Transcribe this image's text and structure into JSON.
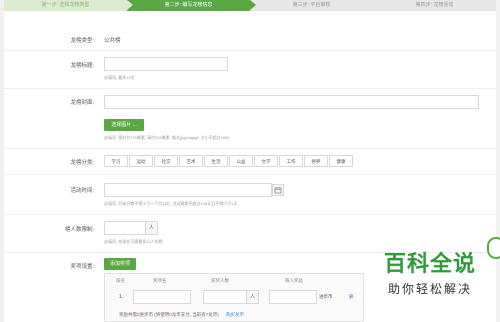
{
  "steps": [
    {
      "label": "第一步: 选择龙榜类型"
    },
    {
      "label": "第二步: 编写龙榜信息"
    },
    {
      "label": "第三步: 平台审核"
    },
    {
      "label": "第四步: 龙榜活动"
    }
  ],
  "form": {
    "type": {
      "label": "龙榜类型:",
      "value": "公共榜"
    },
    "title": {
      "label": "龙榜标题:",
      "value": "",
      "hint": "必填项, 最多15字"
    },
    "cover": {
      "label": "龙榜封面:",
      "button": "选择图片 ...",
      "hint": "必填项, 宽约为700像素, 高约200像素, 格式jpg/png/gif, 大小不超过100K"
    },
    "category": {
      "label": "龙榜分类:",
      "options": [
        "学习",
        "运动",
        "社交",
        "艺术",
        "生活",
        "公益",
        "文学",
        "工作",
        "修养",
        "健康"
      ]
    },
    "time": {
      "label": "活动时间:",
      "value": "",
      "hint": "必填项, 开始日期不得小于一个月以后, 活动周期不超过100天且不得少于1天"
    },
    "limit": {
      "label": "榜人数限制:",
      "value": "",
      "unit": "人",
      "hint": "必填项, 你现在可建最多10人的榜"
    },
    "prize": {
      "label": "奖项设置:",
      "add_button": "添加奖项",
      "headers": [
        "排名",
        "奖项名",
        "获奖人数",
        "每人奖励"
      ],
      "rows": [
        {
          "rank": "1.",
          "people_unit": "人",
          "reward_unit": "进步币",
          "action": "删"
        }
      ],
      "summary_prefix": "奖励共需",
      "summary_total": "0",
      "summary_mid": "进步币 (将使用",
      "summary_use": "0",
      "summary_mid2": "龙币支付, 当前有",
      "summary_have": "7",
      "summary_suffix": "龙币)",
      "buy_link": "购买龙币"
    }
  },
  "watermark": {
    "title": "百科全说",
    "subtitle": "助你轻松解决"
  },
  "colors": {
    "accent": "#5aa844",
    "warning": "#e04040",
    "link": "#3d7fc9"
  }
}
